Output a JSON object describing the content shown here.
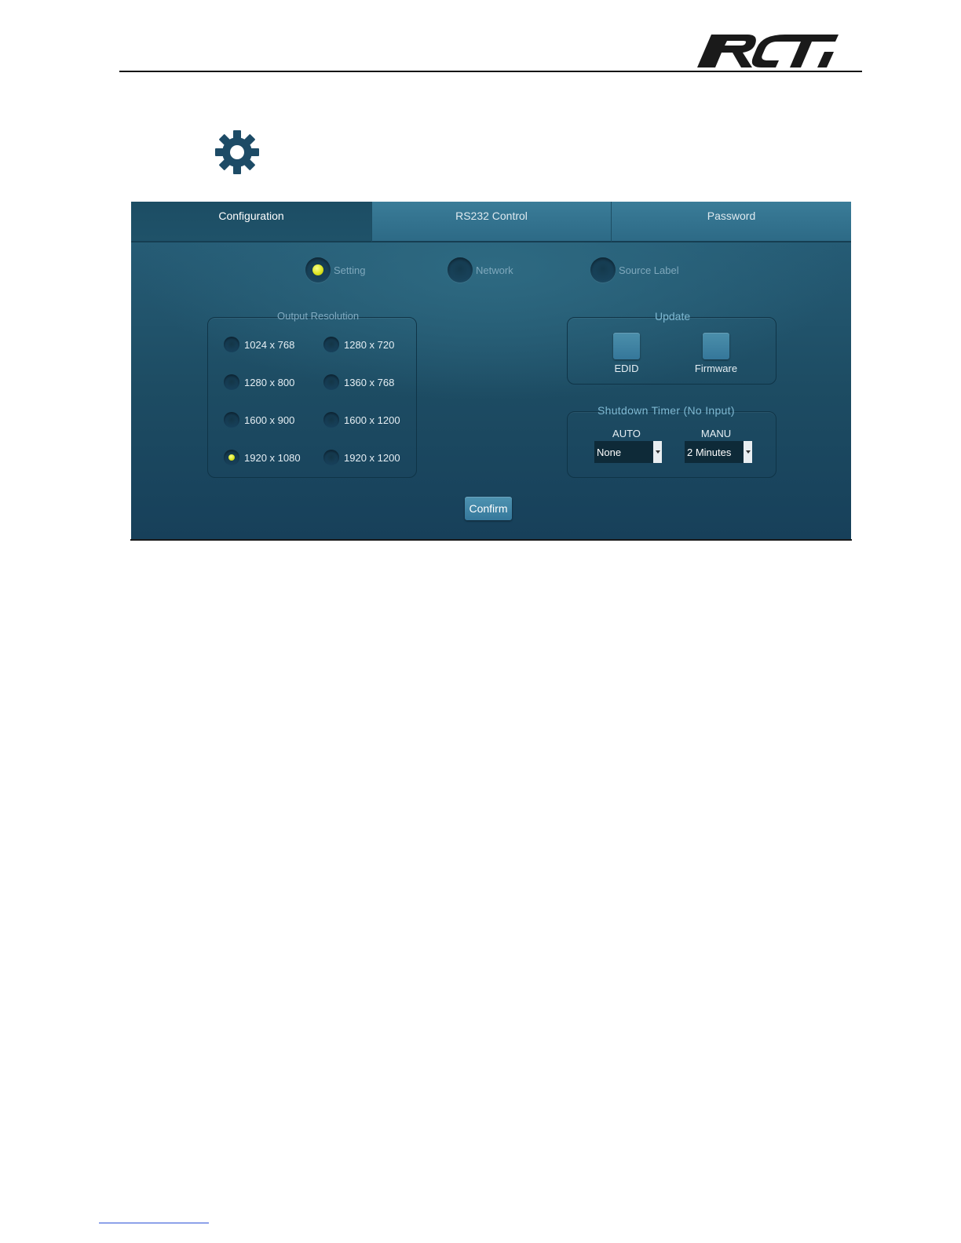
{
  "brand": {
    "logo_text": "RTI"
  },
  "tabs": [
    {
      "label": "Configuration",
      "active": true
    },
    {
      "label": "RS232 Control",
      "active": false
    },
    {
      "label": "Password",
      "active": false
    }
  ],
  "subtabs": [
    {
      "label": "Setting",
      "selected": true
    },
    {
      "label": "Network",
      "selected": false
    },
    {
      "label": "Source Label",
      "selected": false
    }
  ],
  "output_resolution": {
    "title": "Output Resolution",
    "options": [
      {
        "label": "1024 x 768",
        "selected": false
      },
      {
        "label": "1280 x 720",
        "selected": false
      },
      {
        "label": "1280 x 800",
        "selected": false
      },
      {
        "label": "1360 x 768",
        "selected": false
      },
      {
        "label": "1600 x 900",
        "selected": false
      },
      {
        "label": "1600 x 1200",
        "selected": false
      },
      {
        "label": "1920 x 1080",
        "selected": true
      },
      {
        "label": "1920 x 1200",
        "selected": false
      }
    ]
  },
  "update": {
    "title": "Update",
    "edid_label": "EDID",
    "firmware_label": "Firmware"
  },
  "shutdown_timer": {
    "title": "Shutdown Timer (No Input)",
    "auto_label": "AUTO",
    "auto_value": "None",
    "manu_label": "MANU",
    "manu_value": "2 Minutes"
  },
  "confirm_label": "Confirm",
  "colors": {
    "panel_bg": "#1f5269",
    "indicator_on": "#d9e21c",
    "group_title": "#80aac0",
    "shutdown_title": "#7fb9d2",
    "button": "#3f84a5"
  }
}
